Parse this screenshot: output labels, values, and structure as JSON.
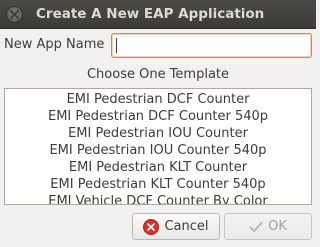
{
  "window": {
    "title": "Create A New EAP Application"
  },
  "form": {
    "name_label": "New App Name",
    "name_value": "",
    "template_heading": "Choose One Template"
  },
  "templates": [
    "EMI Pedestrian DCF Counter",
    "EMI Pedestrian DCF Counter 540p",
    "EMI Pedestrian IOU Counter",
    "EMI Pedestrian IOU Counter 540p",
    "EMI Pedestrian KLT Counter",
    "EMI Pedestrian KLT Counter 540p",
    "EMI Vehicle DCF Counter By Color"
  ],
  "buttons": {
    "cancel_label": "Cancel",
    "ok_label": "OK"
  },
  "icons": {
    "window_close": "close-icon",
    "cancel": "cancel-icon",
    "ok": "checkmark-icon"
  },
  "colors": {
    "titlebar": "#3c3b37",
    "input_focus_border": "#f07746",
    "cancel_icon": "#d8322b",
    "window_bg": "#f2f1f0"
  }
}
